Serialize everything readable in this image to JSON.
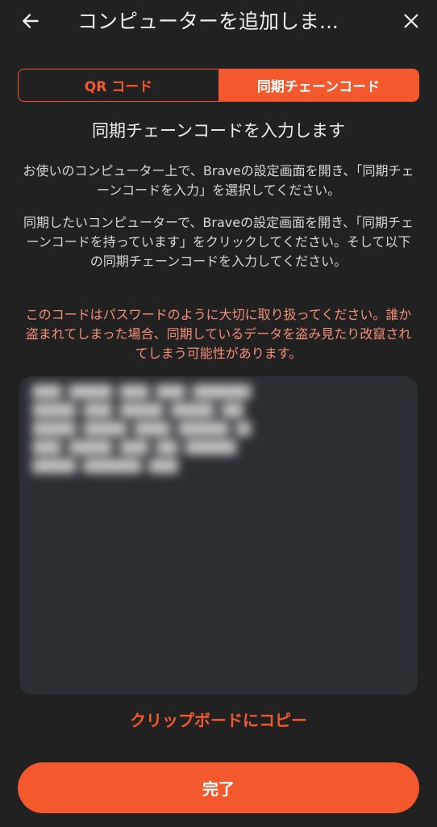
{
  "header": {
    "title": "コンピューターを追加しま...",
    "back_icon": "arrow-left-icon",
    "close_icon": "close-icon"
  },
  "tabs": {
    "qr": "QR コード",
    "chain": "同期チェーンコード",
    "active": "chain"
  },
  "heading": "同期チェーンコードを入力します",
  "instructions": {
    "p1": "お使いのコンピューター上で、Braveの設定画面を開き、「同期チェーンコードを入力」を選択してください。",
    "p2": "同期したいコンピューターで、Braveの設定画面を開き、「同期チェーンコードを持っています」をクリックしてください。そして以下の同期チェーンコードを入力してください。"
  },
  "warning": "このコードはパスワードのように大切に取り扱ってください。誰か盗まれてしまった場合、同期しているデータを盗み見たり改竄されてしまう可能性があります。",
  "copy_label": "クリップボードにコピー",
  "done_label": "完了",
  "colors": {
    "accent": "#f4582d",
    "background": "#212121",
    "warning": "#f58f7a",
    "code_box": "#2b2e33"
  }
}
